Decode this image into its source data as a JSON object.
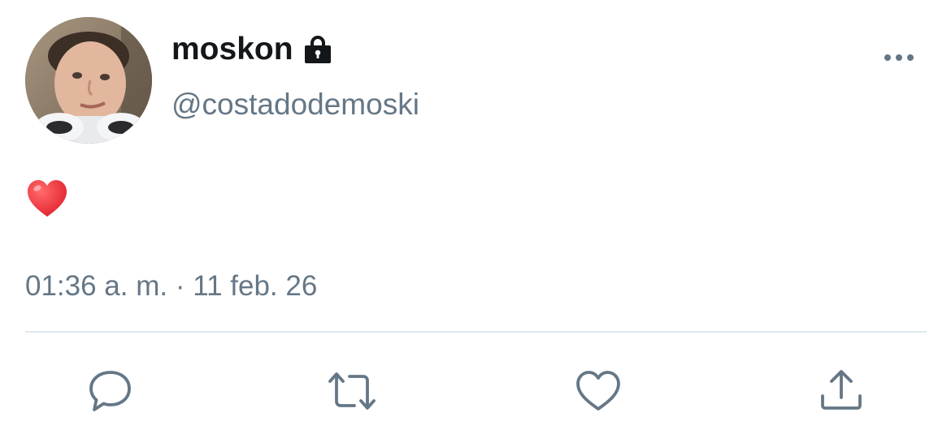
{
  "tweet": {
    "author": {
      "display_name": "moskon",
      "handle": "@costadodemoski",
      "protected_icon": "lock-icon",
      "avatar": "profile-photo"
    },
    "text_emoji": "red-heart-emoji",
    "timestamp": "01:36 a. m. · 11 feb. 26",
    "more_icon": "more-horizontal-icon"
  },
  "actions": [
    {
      "icon": "reply-icon"
    },
    {
      "icon": "retweet-icon"
    },
    {
      "icon": "like-icon"
    },
    {
      "icon": "share-icon"
    }
  ],
  "colors": {
    "name": "#14171a",
    "secondary_text": "#657786",
    "divider": "#e1e8ed",
    "heart": "#e0245e"
  }
}
